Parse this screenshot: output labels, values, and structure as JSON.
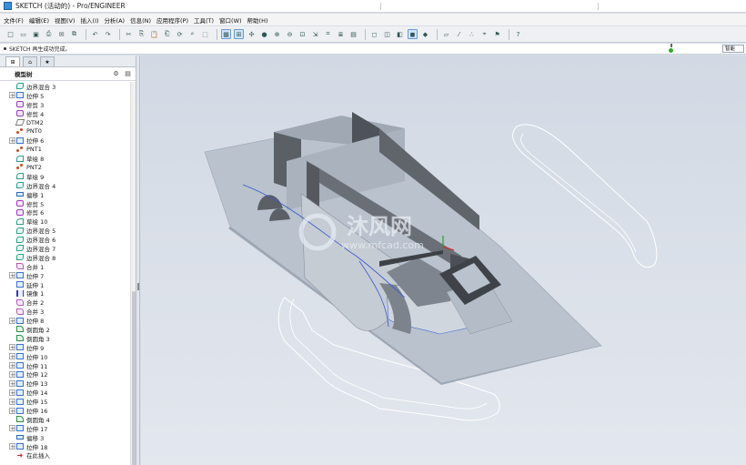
{
  "window": {
    "title": "SKETCH (活动的) - Pro/ENGINEER"
  },
  "menu": [
    "文件(F)",
    "编辑(E)",
    "视图(V)",
    "插入(I)",
    "分析(A)",
    "信息(N)",
    "应用程序(P)",
    "工具(T)",
    "窗口(W)",
    "帮助(H)"
  ],
  "message": "SKETCH 再生成功完成。",
  "filter_label": "智能",
  "panel": {
    "title": "模型树"
  },
  "tree": [
    {
      "label": "边界混合 3",
      "icon": "blend",
      "expand": false
    },
    {
      "label": "拉伸 5",
      "icon": "extrude",
      "expand": true
    },
    {
      "label": "修剪 3",
      "icon": "trim",
      "expand": false
    },
    {
      "label": "修剪 4",
      "icon": "trim",
      "expand": false
    },
    {
      "label": "DTM2",
      "icon": "datum",
      "expand": false
    },
    {
      "label": "PNT0",
      "icon": "point",
      "expand": false
    },
    {
      "label": "拉伸 6",
      "icon": "extrude",
      "expand": true
    },
    {
      "label": "PNT1",
      "icon": "point",
      "expand": false
    },
    {
      "label": "草绘 8",
      "icon": "sketch",
      "expand": false
    },
    {
      "label": "PNT2",
      "icon": "point",
      "expand": false
    },
    {
      "label": "草绘 9",
      "icon": "sketch",
      "expand": false
    },
    {
      "label": "边界混合 4",
      "icon": "blend",
      "expand": false
    },
    {
      "label": "偏移 1",
      "icon": "offset",
      "expand": false
    },
    {
      "label": "修剪 5",
      "icon": "trim",
      "expand": false
    },
    {
      "label": "修剪 6",
      "icon": "trim",
      "expand": false
    },
    {
      "label": "草绘 10",
      "icon": "sketch",
      "expand": false
    },
    {
      "label": "边界混合 5",
      "icon": "blend",
      "expand": false
    },
    {
      "label": "边界混合 6",
      "icon": "blend",
      "expand": false
    },
    {
      "label": "边界混合 7",
      "icon": "blend",
      "expand": false
    },
    {
      "label": "边界混合 8",
      "icon": "blend",
      "expand": false
    },
    {
      "label": "合并 1",
      "icon": "merge",
      "expand": false
    },
    {
      "label": "拉伸 7",
      "icon": "extrude",
      "expand": true
    },
    {
      "label": "延伸 1",
      "icon": "extrude",
      "expand": false
    },
    {
      "label": "镜像 1",
      "icon": "mirror",
      "expand": false
    },
    {
      "label": "合并 2",
      "icon": "merge",
      "expand": false
    },
    {
      "label": "合并 3",
      "icon": "merge",
      "expand": false
    },
    {
      "label": "拉伸 8",
      "icon": "extrude",
      "expand": true
    },
    {
      "label": "倒圆角 2",
      "icon": "round",
      "expand": false
    },
    {
      "label": "倒圆角 3",
      "icon": "round",
      "expand": false
    },
    {
      "label": "拉伸 9",
      "icon": "extrude",
      "expand": true
    },
    {
      "label": "拉伸 10",
      "icon": "extrude",
      "expand": true
    },
    {
      "label": "拉伸 11",
      "icon": "extrude",
      "expand": true
    },
    {
      "label": "拉伸 12",
      "icon": "extrude",
      "expand": true
    },
    {
      "label": "拉伸 13",
      "icon": "extrude",
      "expand": true
    },
    {
      "label": "拉伸 14",
      "icon": "extrude",
      "expand": true
    },
    {
      "label": "拉伸 15",
      "icon": "extrude",
      "expand": true
    },
    {
      "label": "拉伸 16",
      "icon": "extrude",
      "expand": true
    },
    {
      "label": "倒圆角 4",
      "icon": "round",
      "expand": false
    },
    {
      "label": "拉伸 17",
      "icon": "extrude",
      "expand": true
    },
    {
      "label": "偏移 3",
      "icon": "offset",
      "expand": false
    },
    {
      "label": "拉伸 18",
      "icon": "extrude",
      "expand": true
    },
    {
      "label": "在此插入",
      "icon": "insert",
      "expand": false
    }
  ],
  "watermark": {
    "text": "沐风网",
    "url": "www.mfcad.com"
  },
  "colors": {
    "surface": "#b9c2cd",
    "wall": "#5b5f66",
    "bg": "#d9dfe8"
  }
}
